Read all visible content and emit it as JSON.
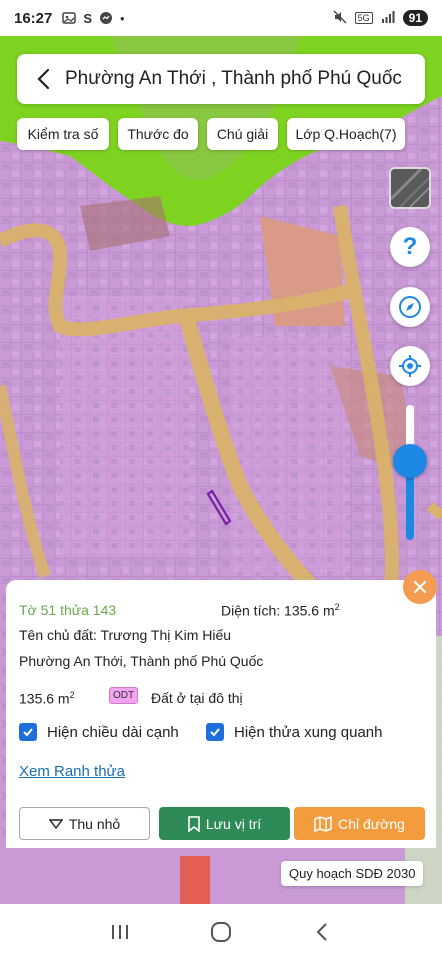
{
  "status_bar": {
    "time": "16:27",
    "left_icons": [
      "image-icon",
      "s-icon",
      "messenger-icon",
      "dot-icon"
    ],
    "battery": "91",
    "network": "5G"
  },
  "header": {
    "title": "Phường An Thới , Thành phố Phú Quốc"
  },
  "toolbar": {
    "chips": [
      {
        "label": "Kiểm tra số"
      },
      {
        "label": "Thước đo"
      },
      {
        "label": "Chú giải"
      },
      {
        "label": "Lớp Q.Hoạch(7)"
      }
    ]
  },
  "map_controls": {
    "help_label": "?"
  },
  "parcel": {
    "sheet_parcel": "Tờ 51 thửa 143",
    "area_label": "Diện tích: 135.6 m",
    "area_sup": "2",
    "owner": "Tên chủ đất: Trương Thị Kim Hiếu",
    "address": "Phường An Thới, Thành phố Phú Quốc",
    "area_value": "135.6 m",
    "area_value_sup": "2",
    "land_code": "ODT",
    "land_use": "Đất ở tại đô thị",
    "option_edges": "Hiện chiều dài cạnh",
    "option_neighbors": "Hiện thửa xung quanh",
    "view_boundary_link": "Xem Ranh thửa",
    "shrink_label": "Thu nhỏ",
    "save_label": "Lưu vị trí",
    "directions_label": "Chỉ đường"
  },
  "plan_badge": "Quy hoạch SDĐ 2030",
  "colors": {
    "residential": "#c99ad6",
    "road": "#d9b26b",
    "green": "#7ed321",
    "accent_blue": "#1e88e5",
    "save_green": "#2e8b57",
    "direction_orange": "#f39c3d"
  }
}
